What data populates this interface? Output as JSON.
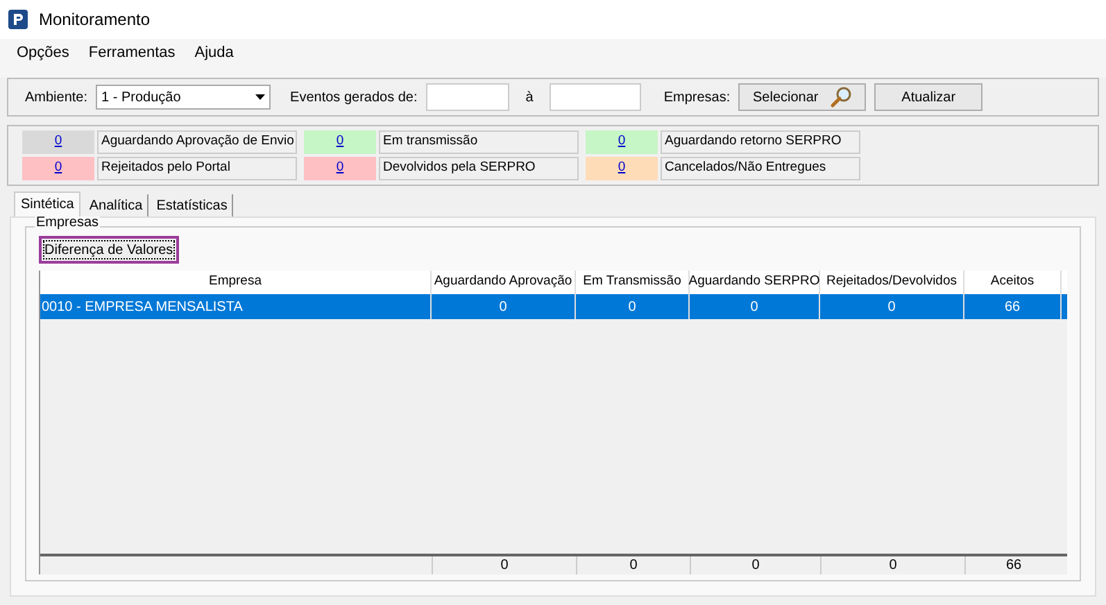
{
  "window": {
    "title": "Monitoramento"
  },
  "menu": [
    "Opções",
    "Ferramentas",
    "Ajuda"
  ],
  "filters": {
    "ambiente_label": "Ambiente:",
    "ambiente_value": "1 - Produção",
    "eventos_label": "Eventos gerados de:",
    "until_label": "à",
    "empresas_label": "Empresas:",
    "select_button": "Selecionar",
    "refresh_button": "Atualizar"
  },
  "status": [
    {
      "count": "0",
      "label": "Aguardando Aprovação de Envio",
      "color": "#d9d9d9"
    },
    {
      "count": "0",
      "label": "Em transmissão",
      "color": "#c6f5c6"
    },
    {
      "count": "0",
      "label": "Aguardando retorno SERPRO",
      "color": "#c6f5c6"
    },
    {
      "count": "0",
      "label": "Rejeitados pelo Portal",
      "color": "#ffc0c4"
    },
    {
      "count": "0",
      "label": "Devolvidos pela SERPRO",
      "color": "#ffc0c4"
    },
    {
      "count": "0",
      "label": "Cancelados/Não Entregues",
      "color": "#ffdcb8"
    }
  ],
  "tabs": [
    {
      "label": "Sintética",
      "selected": true
    },
    {
      "label": "Analítica",
      "selected": false
    },
    {
      "label": "Estatísticas",
      "selected": false
    }
  ],
  "group": {
    "title": "Empresas",
    "button": "Diferença de Valores"
  },
  "table": {
    "columns": [
      "Empresa",
      "Aguardando Aprovação",
      "Em Transmissão",
      "Aguardando SERPRO",
      "Rejeitados/Devolvidos",
      "Aceitos"
    ],
    "rows": [
      {
        "cells": [
          "0010 - EMPRESA MENSALISTA",
          "0",
          "0",
          "0",
          "0",
          "66"
        ],
        "selected": true
      }
    ],
    "totals": [
      "0",
      "0",
      "0",
      "0",
      "66"
    ]
  }
}
